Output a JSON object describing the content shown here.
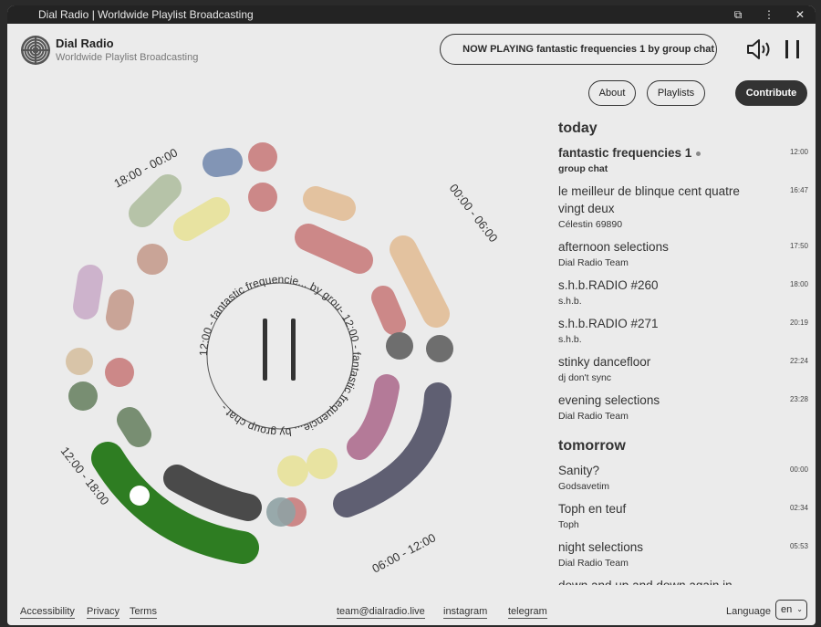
{
  "window": {
    "title": "Dial Radio | Worldwide Playlist Broadcasting"
  },
  "header": {
    "brand_title": "Dial Radio",
    "brand_subtitle": "Worldwide Playlist Broadcasting",
    "now_playing": "NOW PLAYING fantastic frequencies 1 by group chat"
  },
  "nav": {
    "about": "About",
    "playlists": "Playlists",
    "contribute": "Contribute"
  },
  "dial": {
    "labels": {
      "q1": "18:00 - 00:00",
      "q2": "00:00 - 06:00",
      "q3": "06:00 - 12:00",
      "q4": "12:00 - 18:00"
    },
    "ring_text": "12:00 - fantastic frequencie... by grou- 12:00 - fantastic frequencie... by group chat - ",
    "colors": {
      "current_show": "#2e7d22",
      "dark_segment": "#4a4a4a",
      "slate": "#5f5f72",
      "mauve": "#b47a98"
    }
  },
  "schedule": {
    "today_label": "today",
    "today": [
      {
        "name": "fantastic frequencies 1",
        "host": "group chat",
        "time": "12:00",
        "current": true
      },
      {
        "name": "le meilleur de blinque cent quatre vingt deux",
        "host": "Célestin 69890",
        "time": "16:47"
      },
      {
        "name": "afternoon selections",
        "host": "Dial Radio Team",
        "time": "17:50"
      },
      {
        "name": "s.h.b.RADIO #260",
        "host": "s.h.b.",
        "time": "18:00"
      },
      {
        "name": "s.h.b.RADIO #271",
        "host": "s.h.b.",
        "time": "20:19"
      },
      {
        "name": "stinky dancefloor",
        "host": "dj don't sync",
        "time": "22:24"
      },
      {
        "name": "evening selections",
        "host": "Dial Radio Team",
        "time": "23:28"
      }
    ],
    "tomorrow_label": "tomorrow",
    "tomorrow": [
      {
        "name": "Sanity?",
        "host": "Godsavetim",
        "time": "00:00"
      },
      {
        "name": "Toph en teuf",
        "host": "Toph",
        "time": "02:34"
      },
      {
        "name": "night selections",
        "host": "Dial Radio Team",
        "time": "05:53"
      },
      {
        "name": "down and up and down again in",
        "host": "",
        "time": ""
      }
    ]
  },
  "footer": {
    "accessibility": "Accessibility",
    "privacy": "Privacy",
    "terms": "Terms",
    "email": "team@dialradio.live",
    "instagram": "instagram",
    "telegram": "telegram",
    "language_label": "Language",
    "language_value": "en"
  }
}
